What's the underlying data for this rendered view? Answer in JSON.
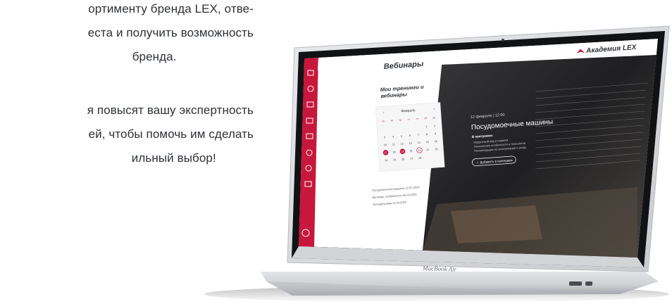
{
  "marketing_copy": {
    "paragraph1": [
      "ортименту бренда LEX, отве-",
      "еста и получить возможность",
      "бренда."
    ],
    "paragraph2": [
      "я повысят вашу экспертность",
      "ей, чтобы помочь им сделать",
      "ильный выбор!"
    ]
  },
  "screen": {
    "brand_name": "Академия LEX",
    "page_title": "Вебинары",
    "section_title": [
      "Мои тренинги и",
      "вебинары"
    ],
    "calendar": {
      "month": "Февраль",
      "weekdays": [
        "пн",
        "вт",
        "ср",
        "чт",
        "пт",
        "сб",
        "вс"
      ],
      "days": [
        [
          "",
          "",
          "",
          "",
          "",
          "1",
          "2"
        ],
        [
          "3",
          "4",
          "5",
          "6",
          "7",
          "8",
          "9"
        ],
        [
          "10",
          "11",
          "12",
          "13",
          "14",
          "15",
          "16"
        ],
        [
          "17",
          "18",
          "19",
          "20",
          "21",
          "22",
          "23"
        ],
        [
          "24",
          "25",
          "26",
          "27",
          "28",
          "",
          ""
        ]
      ],
      "highlighted_days": [
        "17",
        "19"
      ],
      "ringed_days": [
        "21"
      ]
    },
    "sidebar_notes": [
      "Посудомоечные машины 12.02.2020",
      "Вытяжки: особенности 05.03.2020",
      "Холодильники 12.03.2020"
    ],
    "hero": {
      "date_line": "12 февраля  |  12:00",
      "title": "Посудомоечные машины",
      "program_label": "В программе:",
      "program_items": [
        "Модельный ряд и новинки",
        "Технические особенности и технологии",
        "Рекомендации по эксплуатации и уходу"
      ],
      "cta_label": "✓ Добавить в календарь"
    },
    "device_label": "MacBook Air"
  },
  "colors": {
    "accent": "#c8173c",
    "panel_dark": "#2b2b2d",
    "body_text": "#2f3136",
    "laptop_silver": "#d7d8dc"
  },
  "icons": [
    "home-icon",
    "calendar-icon",
    "book-icon",
    "video-icon",
    "chat-icon",
    "user-icon",
    "settings-icon",
    "logout-icon",
    "brand-logo-icon"
  ]
}
